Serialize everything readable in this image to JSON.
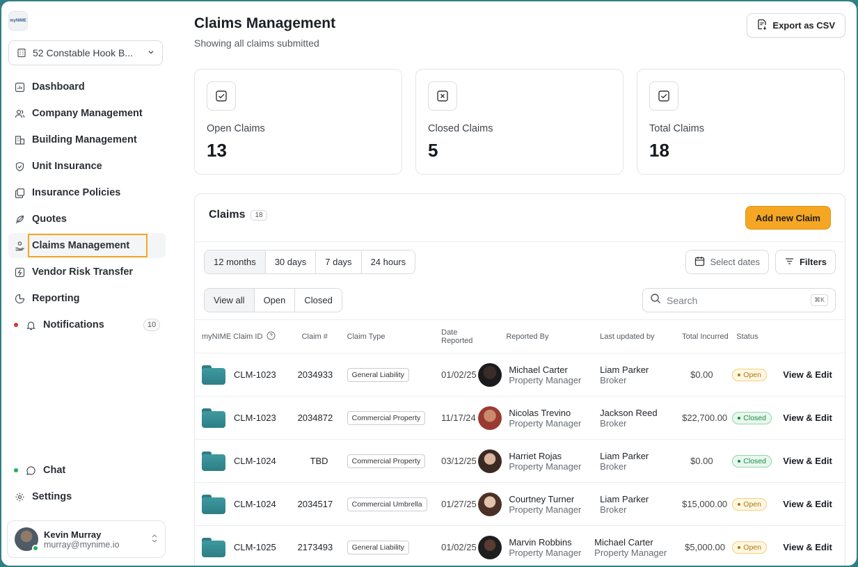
{
  "sidebar": {
    "logo_text": "myNIME",
    "building_select": "52 Constable Hook B...",
    "items": [
      {
        "label": "Dashboard",
        "icon": "dashboard-icon"
      },
      {
        "label": "Company Management",
        "icon": "users-icon"
      },
      {
        "label": "Building Management",
        "icon": "building-icon"
      },
      {
        "label": "Unit Insurance",
        "icon": "shield-icon"
      },
      {
        "label": "Insurance Policies",
        "icon": "policies-icon"
      },
      {
        "label": "Quotes",
        "icon": "quote-icon"
      },
      {
        "label": "Claims Management",
        "icon": "claims-icon",
        "active": true
      },
      {
        "label": "Vendor Risk Transfer",
        "icon": "transfer-icon"
      },
      {
        "label": "Reporting",
        "icon": "pie-chart-icon"
      },
      {
        "label": "Notifications",
        "icon": "bell-icon",
        "count": "10"
      }
    ],
    "bottom": [
      {
        "label": "Chat",
        "icon": "chat-icon"
      },
      {
        "label": "Settings",
        "icon": "gear-icon"
      }
    ],
    "user": {
      "name": "Kevin Murray",
      "email": "murray@mynime.io"
    }
  },
  "header": {
    "title": "Claims Management",
    "subtitle": "Showing all claims submitted",
    "export_label": "Export as CSV"
  },
  "stats": [
    {
      "label": "Open Claims",
      "value": "13",
      "icon": "check-square-icon"
    },
    {
      "label": "Closed Claims",
      "value": "5",
      "icon": "x-square-icon"
    },
    {
      "label": "Total Claims",
      "value": "18",
      "icon": "check-square-icon"
    }
  ],
  "claims": {
    "title": "Claims",
    "count": "18",
    "add_label": "Add new Claim",
    "time_ranges": [
      "12 months",
      "30 days",
      "7 days",
      "24 hours"
    ],
    "select_dates": "Select dates",
    "filters": "Filters",
    "views": [
      "View all",
      "Open",
      "Closed"
    ],
    "search_placeholder": "Search",
    "search_kbd": "⌘K",
    "columns": [
      "myNIME Claim ID",
      "Claim #",
      "Claim Type",
      "Date Reported",
      "Reported By",
      "Last updated by",
      "Total Incurred",
      "Status",
      ""
    ],
    "rows": [
      {
        "id": "CLM-1023",
        "num": "2034933",
        "type": "General Liability",
        "date": "01/02/25",
        "rep_name": "Michael Carter",
        "rep_role": "Property Manager",
        "upd_name": "Liam Parker",
        "upd_role": "Broker",
        "total": "$0.00",
        "status": "Open",
        "action": "View & Edit"
      },
      {
        "id": "CLM-1023",
        "num": "2034872",
        "type": "Commercial Property",
        "date": "11/17/24",
        "rep_name": "Nicolas Trevino",
        "rep_role": "Property Manager",
        "upd_name": "Jackson Reed",
        "upd_role": "Broker",
        "total": "$22,700.00",
        "status": "Closed",
        "action": "View & Edit"
      },
      {
        "id": "CLM-1024",
        "num": "TBD",
        "type": "Commercial Property",
        "date": "03/12/25",
        "rep_name": "Harriet Rojas",
        "rep_role": "Property Manager",
        "upd_name": "Liam Parker",
        "upd_role": "Broker",
        "total": "$0.00",
        "status": "Closed",
        "action": "View & Edit"
      },
      {
        "id": "CLM-1024",
        "num": "2034517",
        "type": "Commercial Umbrella",
        "date": "01/27/25",
        "rep_name": "Courtney Turner",
        "rep_role": "Property Manager",
        "upd_name": "Liam Parker",
        "upd_role": "Broker",
        "total": "$15,000.00",
        "status": "Open",
        "action": "View & Edit"
      },
      {
        "id": "CLM-1025",
        "num": "2173493",
        "type": "General Liability",
        "date": "01/02/25",
        "rep_name": "Marvin Robbins",
        "rep_role": "Property Manager",
        "upd_name": "Michael Carter",
        "upd_role": "Property Manager",
        "total": "$5,000.00",
        "status": "Open",
        "action": "View & Edit"
      }
    ]
  },
  "colors": {
    "accent": "#f5a623",
    "frame": "#2f7f86",
    "folder": "#2f7c82",
    "open": "#b07908",
    "closed": "#178a48"
  }
}
